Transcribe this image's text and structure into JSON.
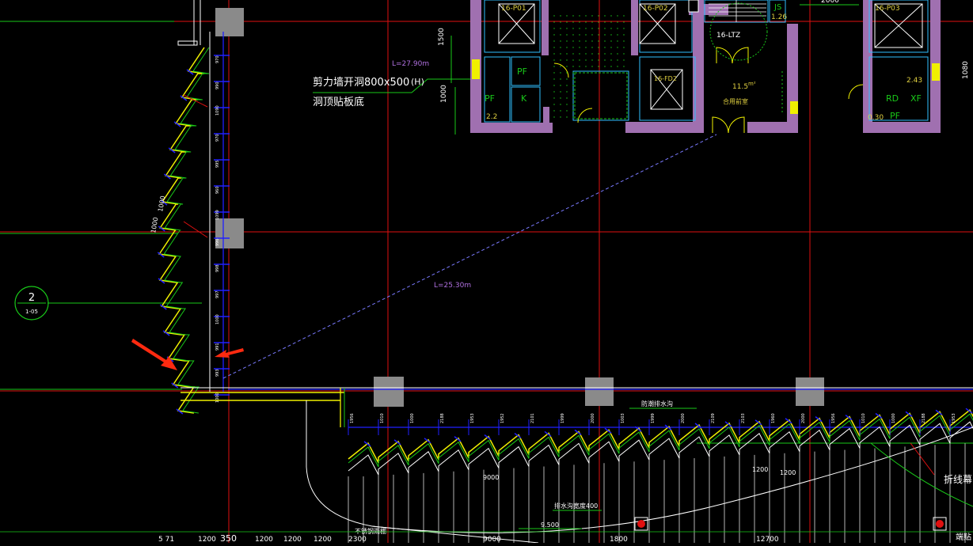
{
  "colors": {
    "background": "#000000",
    "grid_red": "#e01010",
    "grid_green": "#19c819",
    "wall_magenta": "#a070b0",
    "wall_yellow": "#f0f000",
    "blue": "#2020ff",
    "cyan": "#30c0ff",
    "white": "#ffffff",
    "arrow": "#ff2a10",
    "column_grey": "#8a8a8a",
    "dash_blue": "#7a7aff",
    "text_yellow": "#e0d040",
    "text_purple": "#b070e0"
  },
  "annotations": {
    "length_top": "L=27.90m",
    "length_mid": "L=25.30m",
    "wall_opening_line1": "剪力墙开洞800x500",
    "wall_opening_line2": "洞顶贴板底",
    "grid_h_bubble": "(H)",
    "axis_bubble_number": "2",
    "axis_bubble_sub": "1-05",
    "dim_1500": "1500",
    "dim_1000": "1000",
    "dim_1080": "1080",
    "dim_right_top": "2000",
    "dim_side_1": "1000",
    "dim_side_2": "1000",
    "bottom_annotation_1": "防潮排水沟",
    "bottom_annotation_2": "排水沟宽度400",
    "bottom_annotation_3": "不锈钢雨棚",
    "bottom_annotation_4": "折线幕",
    "bottom_annotation_5": "端贴",
    "bottom_dim_9500": "9.500",
    "bottom_dim_1200": "1200",
    "bottom_dim_1200b": "1200",
    "bottom_dim_9000": "9000"
  },
  "rooms": [
    {
      "label": "PF",
      "color": "#19c819"
    },
    {
      "label": "K",
      "color": "#19c819"
    },
    {
      "label": "PF",
      "color": "#19c819"
    },
    {
      "label": "RD",
      "color": "#19c819"
    },
    {
      "label": "XF",
      "color": "#19c819"
    },
    {
      "label": "PF",
      "color": "#19c819"
    }
  ],
  "room_tags": {
    "tag_p01": "16-P01",
    "tag_p02": "16-P02",
    "tag_p03": "16-P03",
    "tag_ltz": "16-LTZ",
    "tag_js": "JS",
    "tag_js_val": "1.26",
    "tag_fd": "16-FD2",
    "tag_area": "11.5",
    "tag_area_unit": "m²",
    "tag_room_name": "合用前室",
    "tag_pf_val": "2.2",
    "tag_xf_val": "2.43",
    "tag_pf2_val": "0.30"
  },
  "bottom_ruler": [
    "5 71",
    "1200",
    "350",
    "1200",
    "1200",
    "1200",
    "2300",
    "9000",
    "1800",
    "12700"
  ],
  "bottom_dims_row": [
    "1956",
    "1010",
    "1000",
    "2188",
    "1953",
    "1952",
    "2101",
    "1999",
    "2000",
    "1003",
    "1999",
    "2000",
    "2109",
    "2103",
    "1960",
    "2000"
  ],
  "vertical_dims": [
    "970",
    "990",
    "1090",
    "970",
    "995",
    "960",
    "1099",
    "996",
    "998",
    "997",
    "1000",
    "991",
    "993",
    "1000",
    "971",
    "1079"
  ]
}
